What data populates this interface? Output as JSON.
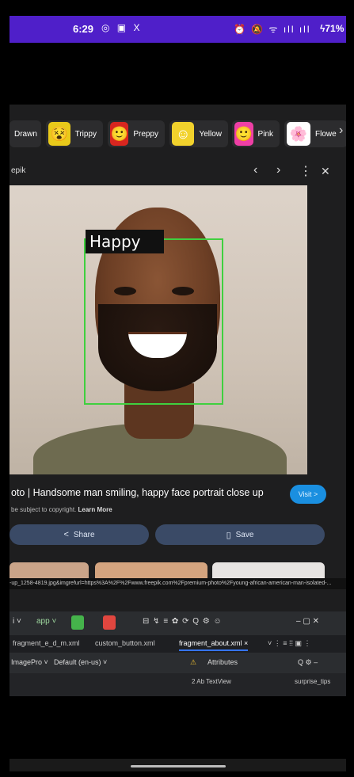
{
  "status_bar": {
    "time": "6:29",
    "left_icons": "◎ ▣ X",
    "right_icons": "⏰ 🔕 ᯤ ıll ıll",
    "battery": "ϟ71%"
  },
  "chips": [
    {
      "label": "Drawn",
      "emoji": "",
      "bg": "#2c2c2e"
    },
    {
      "label": "Trippy",
      "emoji": "😵",
      "bg": "#e9c91a"
    },
    {
      "label": "Preppy",
      "emoji": "🙂",
      "bg": "#d8261f"
    },
    {
      "label": "Yellow",
      "emoji": "☺",
      "bg": "#f2d22c"
    },
    {
      "label": "Pink",
      "emoji": "🙂",
      "bg": "#ef3fa5"
    },
    {
      "label": "Flowe",
      "emoji": "🌸",
      "bg": "#ffffff"
    }
  ],
  "chips_next_icon": "›",
  "viewer": {
    "source": "epik",
    "prev_icon": "‹",
    "next_icon": "›",
    "more_icon": "⋮",
    "close_icon": "✕"
  },
  "detection": {
    "label": "Happy"
  },
  "caption": {
    "title": "oto | Handsome man smiling, happy face portrait close up",
    "copyright": "be subject to copyright.",
    "learn_more": "Learn More",
    "visit_label": "Visit >"
  },
  "actions": {
    "share_label": "Share",
    "share_icon": "<",
    "save_label": "Save",
    "save_icon": "▯"
  },
  "url_text": "-up_1258-4819.jpg&imgrefurl=https%3A%2F%2Fwww.freepik.com%2Fpremium-photo%2Fyoung-african-american-man-isolated-...",
  "ide": {
    "toolbar_left": "i ˅",
    "app_label": "app ˅",
    "toolbar_icons": "⊟  ↯  ≡  ✿  ⟳  Q  ⚙  ☺",
    "window_icons": "–   ▢   ✕",
    "tabs": [
      {
        "label": "fragment_e_d_m.xml",
        "active": false
      },
      {
        "label": "custom_button.xml",
        "active": false
      },
      {
        "label": "fragment_about.xml  ×",
        "active": true
      }
    ],
    "tabs_right": "˅  ⋮  ≡  ⁞⁞  ▣  ⋮",
    "theme_label": "ImagePro ˅",
    "locale_label": "Default (en-us) ˅",
    "warning_icon": "⚠",
    "attributes_label": "Attributes",
    "attributes_icons": "Q  ⚙  –",
    "row_text": "2   Ab TextView",
    "row_right": "surprise_tips"
  }
}
